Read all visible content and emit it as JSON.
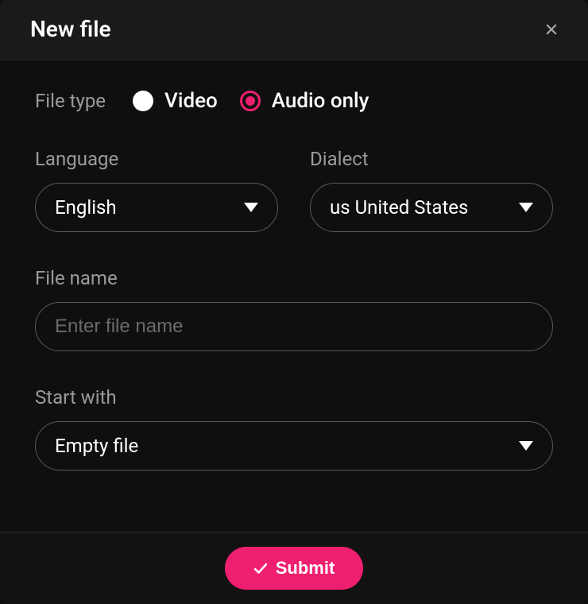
{
  "header": {
    "title": "New file"
  },
  "fileType": {
    "label": "File type",
    "options": {
      "video": "Video",
      "audio": "Audio only"
    },
    "selected": "audio"
  },
  "language": {
    "label": "Language",
    "value": "English"
  },
  "dialect": {
    "label": "Dialect",
    "value": "us United States"
  },
  "fileName": {
    "label": "File name",
    "placeholder": "Enter file name",
    "value": ""
  },
  "startWith": {
    "label": "Start with",
    "value": "Empty file"
  },
  "footer": {
    "submit": "Submit"
  }
}
